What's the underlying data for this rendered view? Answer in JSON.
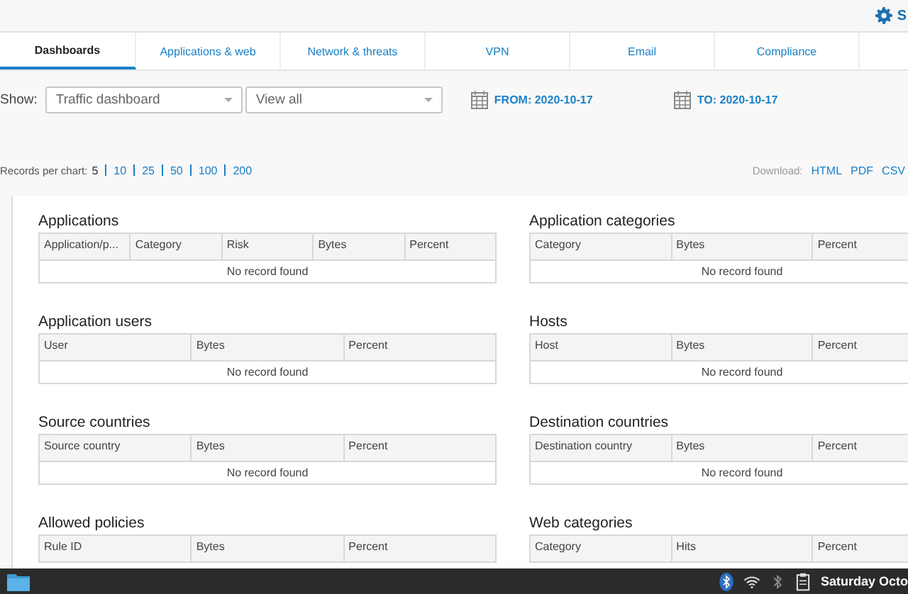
{
  "top_bar": {
    "settings_label": "S"
  },
  "tabs": [
    {
      "label": "Dashboards",
      "selected": true
    },
    {
      "label": "Applications & web",
      "selected": false
    },
    {
      "label": "Network & threats",
      "selected": false
    },
    {
      "label": "VPN",
      "selected": false
    },
    {
      "label": "Email",
      "selected": false
    },
    {
      "label": "Compliance",
      "selected": false
    }
  ],
  "filters": {
    "show_label": "Show:",
    "dashboard_select": "Traffic dashboard",
    "view_select": "View all",
    "from": "FROM: 2020-10-17",
    "to": "TO: 2020-10-17"
  },
  "records_per_chart": {
    "label": "Records per chart:",
    "options": [
      {
        "label": "5",
        "selected": true
      },
      {
        "label": "10",
        "selected": false
      },
      {
        "label": "25",
        "selected": false
      },
      {
        "label": "50",
        "selected": false
      },
      {
        "label": "100",
        "selected": false
      },
      {
        "label": "200",
        "selected": false
      }
    ]
  },
  "download": {
    "label": "Download:",
    "formats": [
      "HTML",
      "PDF",
      "CSV"
    ]
  },
  "panels": [
    {
      "title": "Applications",
      "columns": [
        "Application/p...",
        "Category",
        "Risk",
        "Bytes",
        "Percent"
      ],
      "empty_text": "No record found"
    },
    {
      "title": "Application categories",
      "columns": [
        "Category",
        "Bytes",
        "Percent"
      ],
      "empty_text": "No record found"
    },
    {
      "title": "Application users",
      "columns": [
        "User",
        "Bytes",
        "Percent"
      ],
      "empty_text": "No record found"
    },
    {
      "title": "Hosts",
      "columns": [
        "Host",
        "Bytes",
        "Percent"
      ],
      "empty_text": "No record found"
    },
    {
      "title": "Source countries",
      "columns": [
        "Source country",
        "Bytes",
        "Percent"
      ],
      "empty_text": "No record found"
    },
    {
      "title": "Destination countries",
      "columns": [
        "Destination country",
        "Bytes",
        "Percent"
      ],
      "empty_text": "No record found"
    },
    {
      "title": "Allowed policies",
      "columns": [
        "Rule ID",
        "Bytes",
        "Percent"
      ]
    },
    {
      "title": "Web categories",
      "columns": [
        "Category",
        "Hits",
        "Percent"
      ]
    }
  ],
  "taskbar": {
    "clock": "Saturday Octo"
  }
}
